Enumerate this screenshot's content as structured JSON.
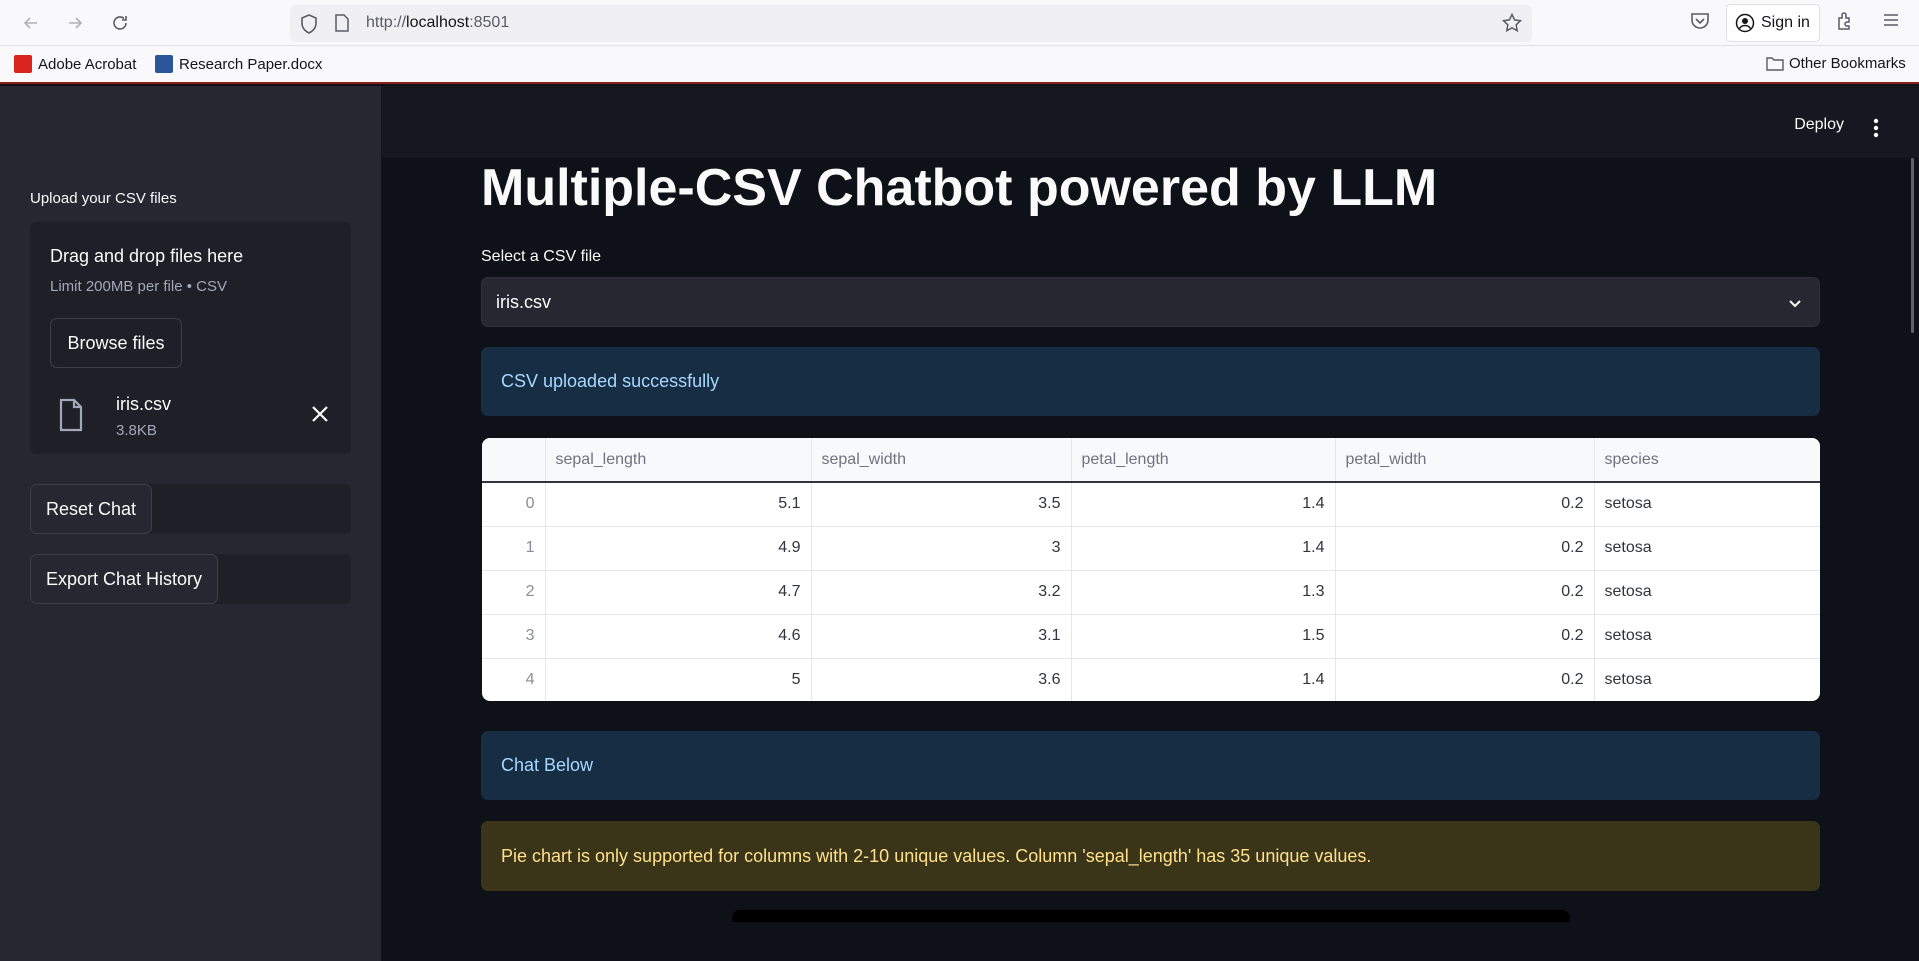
{
  "browser": {
    "url_prefix": "http://",
    "url_host": "localhost",
    "url_port": ":8501",
    "signin_label": "Sign in",
    "bookmarks": [
      "Adobe Acrobat",
      "Research Paper.docx"
    ],
    "other_bookmarks": "Other Bookmarks"
  },
  "header": {
    "deploy_label": "Deploy"
  },
  "sidebar": {
    "upload_label": "Upload your CSV files",
    "dropzone_title": "Drag and drop files here",
    "dropzone_limit": "Limit 200MB per file • CSV",
    "browse_label": "Browse files",
    "file": {
      "name": "iris.csv",
      "size": "3.8KB"
    },
    "reset_label": "Reset Chat",
    "export_label": "Export Chat History"
  },
  "main": {
    "title": "Multiple-CSV Chatbot powered by LLM",
    "select_label": "Select a CSV file",
    "select_value": "iris.csv",
    "upload_success": "CSV uploaded successfully",
    "chat_below": "Chat Below",
    "warning": "Pie chart is only supported for columns with 2-10 unique values. Column 'sepal_length' has 35 unique values."
  },
  "table": {
    "columns": [
      "sepal_length",
      "sepal_width",
      "petal_length",
      "petal_width",
      "species"
    ],
    "rows": [
      [
        "0",
        "5.1",
        "3.5",
        "1.4",
        "0.2",
        "setosa"
      ],
      [
        "1",
        "4.9",
        "3",
        "1.4",
        "0.2",
        "setosa"
      ],
      [
        "2",
        "4.7",
        "3.2",
        "1.3",
        "0.2",
        "setosa"
      ],
      [
        "3",
        "4.6",
        "3.1",
        "1.5",
        "0.2",
        "setosa"
      ],
      [
        "4",
        "5",
        "3.6",
        "1.4",
        "0.2",
        "setosa"
      ]
    ]
  },
  "colors": {
    "sidebar_bg": "#262730",
    "main_bg": "#0e1117",
    "info_bg": "#172d43",
    "warning_bg": "#3a3519"
  }
}
